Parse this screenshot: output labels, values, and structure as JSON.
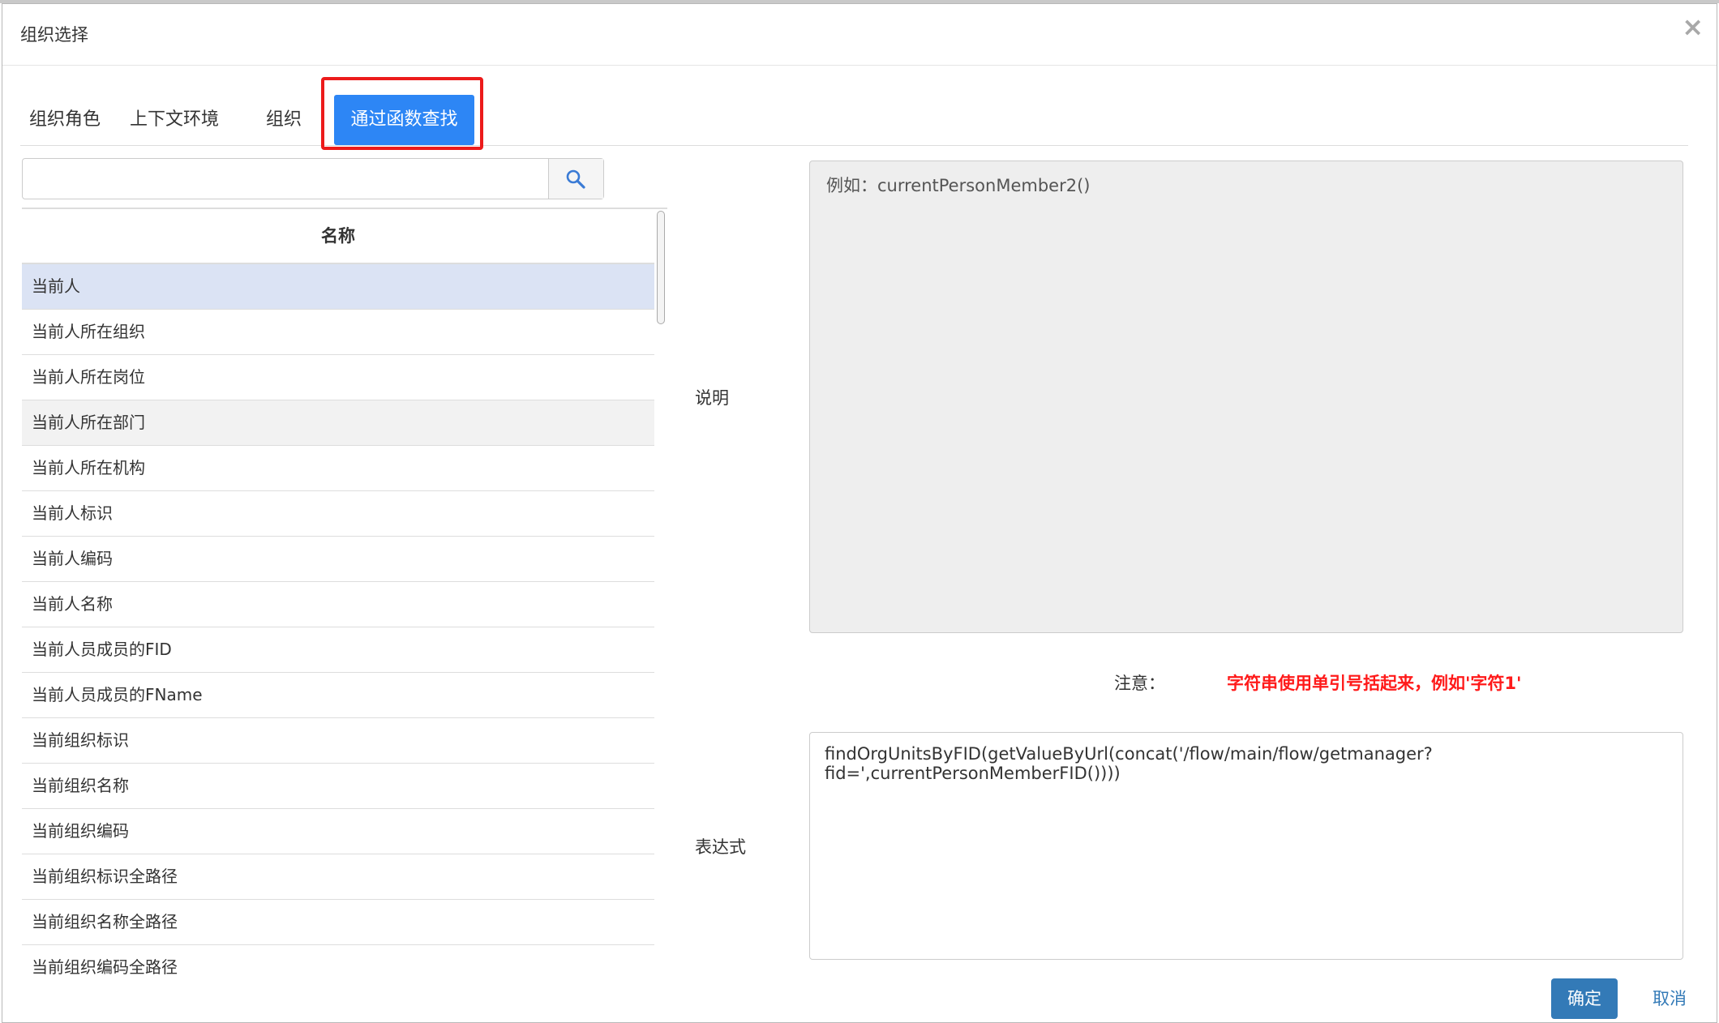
{
  "modal": {
    "title": "组织选择",
    "close_symbol": "×"
  },
  "tabs": [
    {
      "label": "组织角色",
      "active": false
    },
    {
      "label": "上下文环境",
      "active": false
    },
    {
      "label": "组织",
      "active": false
    },
    {
      "label": "通过函数查找",
      "active": true
    }
  ],
  "search": {
    "value": "",
    "icon": "search-icon"
  },
  "list": {
    "header": "名称",
    "items": [
      "当前人",
      "当前人所在组织",
      "当前人所在岗位",
      "当前人所在部门",
      "当前人所在机构",
      "当前人标识",
      "当前人编码",
      "当前人名称",
      "当前人员成员的FID",
      "当前人员成员的FName",
      "当前组织标识",
      "当前组织名称",
      "当前组织编码",
      "当前组织标识全路径",
      "当前组织名称全路径",
      "当前组织编码全路径"
    ],
    "selected_index": 0,
    "hover_index": 3
  },
  "form": {
    "desc_label": "说明",
    "desc_text": "例如：currentPersonMember2()",
    "note_label": "注意：",
    "note_text": "字符串使用单引号括起来，例如'字符1'",
    "expr_label": "表达式",
    "expr_value": "findOrgUnitsByFID(getValueByUrl(concat('/flow/main/flow/getmanager?fid=',currentPersonMemberFID())))"
  },
  "buttons": {
    "ok": "确定",
    "cancel": "取消"
  },
  "colors": {
    "active_tab": "#2d86f5",
    "highlight": "#ec1b1b",
    "note": "#ff1a1a",
    "primary": "#337ab7",
    "selected_row": "#dbe3f4"
  }
}
